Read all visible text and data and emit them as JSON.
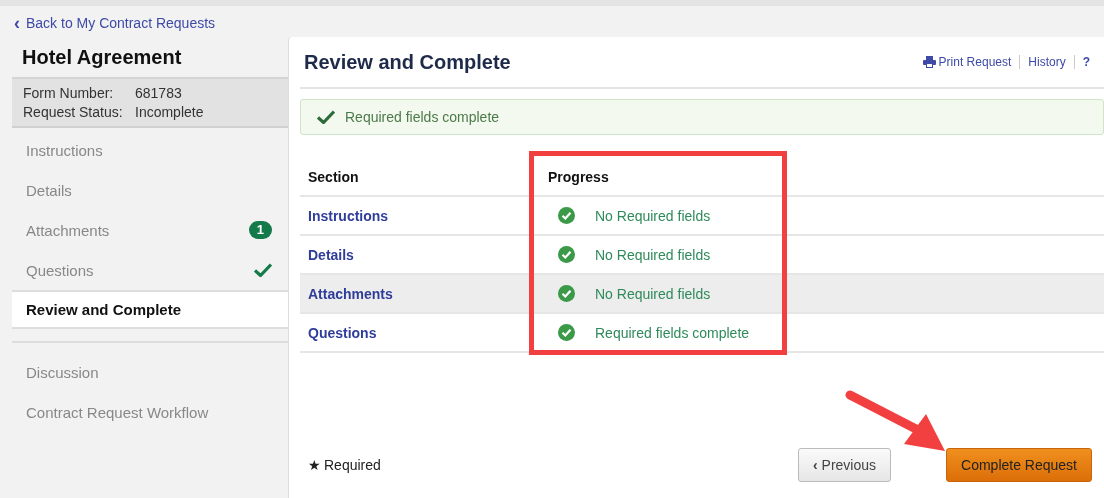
{
  "back_link": {
    "chevron": "‹",
    "label": "Back to My Contract Requests"
  },
  "sidebar": {
    "title": "Hotel Agreement",
    "info": [
      {
        "label": "Form Number:",
        "value": "681783"
      },
      {
        "label": "Request Status:",
        "value": "Incomplete"
      }
    ],
    "items": [
      {
        "label": "Instructions",
        "selected": false,
        "kind": "plain"
      },
      {
        "label": "Details",
        "selected": false,
        "kind": "plain"
      },
      {
        "label": "Attachments",
        "selected": false,
        "kind": "badge",
        "badge": "1"
      },
      {
        "label": "Questions",
        "selected": false,
        "kind": "check"
      },
      {
        "label": "Review and Complete",
        "selected": true,
        "kind": "plain"
      }
    ],
    "lower_items": [
      {
        "label": "Discussion",
        "selected": false
      },
      {
        "label": "Contract Request Workflow",
        "selected": false
      }
    ]
  },
  "main": {
    "title": "Review and Complete",
    "header_links": [
      "Print Request",
      "History",
      "?"
    ],
    "alert": "Required fields complete",
    "table": {
      "columns": [
        "Section",
        "Progress"
      ],
      "rows": [
        {
          "section": "Instructions",
          "progress": "No Required fields",
          "complete": true,
          "highlighted": false
        },
        {
          "section": "Details",
          "progress": "No Required fields",
          "complete": true,
          "highlighted": false
        },
        {
          "section": "Attachments",
          "progress": "No Required fields",
          "complete": true,
          "highlighted": true
        },
        {
          "section": "Questions",
          "progress": "Required fields complete",
          "complete": true,
          "highlighted": false
        }
      ]
    },
    "legend": {
      "star": "★",
      "label": "Required"
    },
    "buttons": [
      {
        "label": "Previous",
        "kind": "secondary",
        "chevron": "‹"
      },
      {
        "label": "Complete Request",
        "kind": "primary"
      }
    ]
  }
}
